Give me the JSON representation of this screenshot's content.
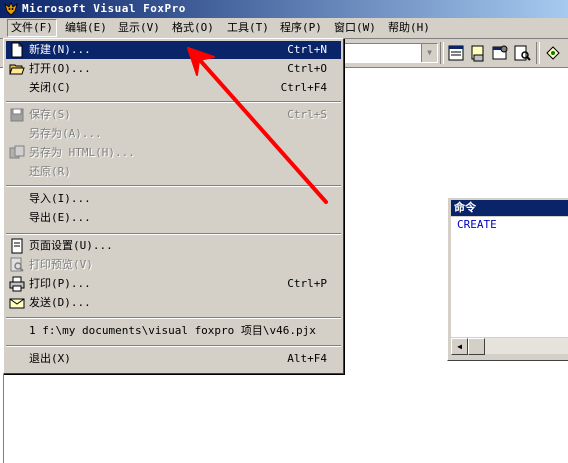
{
  "window": {
    "title": "Microsoft Visual FoxPro"
  },
  "menubar": {
    "items": [
      {
        "label": "文件(F)"
      },
      {
        "label": "编辑(E)"
      },
      {
        "label": "显示(V)"
      },
      {
        "label": "格式(O)"
      },
      {
        "label": "工具(T)"
      },
      {
        "label": "程序(P)"
      },
      {
        "label": "窗口(W)"
      },
      {
        "label": "帮助(H)"
      }
    ]
  },
  "toolbar": {
    "combo_value": ""
  },
  "file_menu": {
    "new": {
      "label": "新建(N)...",
      "shortcut": "Ctrl+N"
    },
    "open": {
      "label": "打开(O)...",
      "shortcut": "Ctrl+O"
    },
    "close": {
      "label": "关闭(C)",
      "shortcut": "Ctrl+F4"
    },
    "save": {
      "label": "保存(S)",
      "shortcut": "Ctrl+S"
    },
    "save_as": {
      "label": "另存为(A)..."
    },
    "save_as_html": {
      "label": "另存为 HTML(H)..."
    },
    "revert": {
      "label": "还原(R)"
    },
    "import": {
      "label": "导入(I)..."
    },
    "export": {
      "label": "导出(E)..."
    },
    "page_setup": {
      "label": "页面设置(U)..."
    },
    "print_preview": {
      "label": "打印预览(V)"
    },
    "print": {
      "label": "打印(P)...",
      "shortcut": "Ctrl+P"
    },
    "send": {
      "label": "发送(D)..."
    },
    "recent_1": {
      "label": "1 f:\\my documents\\visual foxpro 项目\\v46.pjx"
    },
    "exit": {
      "label": "退出(X)",
      "shortcut": "Alt+F4"
    }
  },
  "command_window": {
    "title": "命令",
    "text": "CREATE"
  },
  "colors": {
    "menu_bg": "#d4d0c8",
    "highlight": "#0a246a",
    "annotation_arrow": "#ff0000"
  }
}
